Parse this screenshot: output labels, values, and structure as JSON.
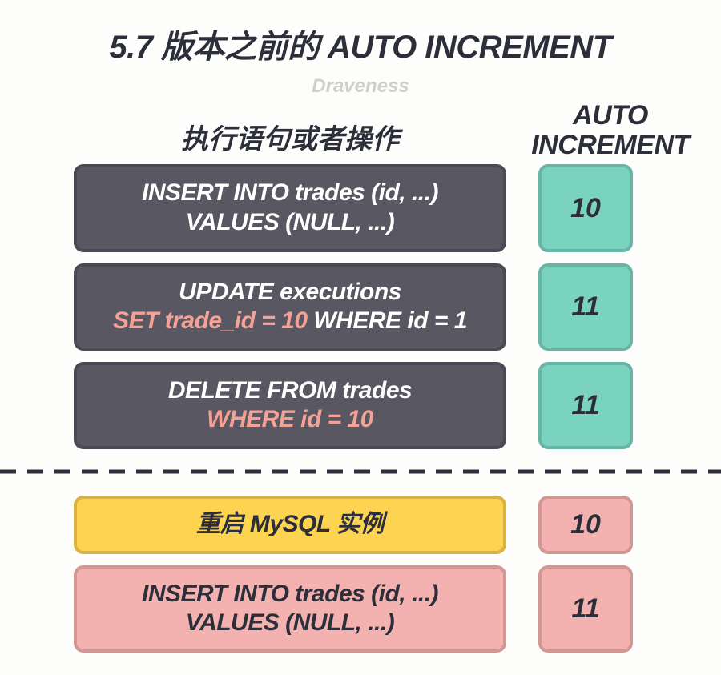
{
  "title": "5.7 版本之前的 AUTO INCREMENT",
  "subtitle": "Draveness",
  "columns": {
    "left": "执行语句或者操作",
    "right_line1": "AUTO",
    "right_line2": "INCREMENT"
  },
  "rows": [
    {
      "op_line1": "INSERT INTO trades (id, ...)",
      "op_line2": "VALUES (NULL, ...)",
      "value": "10"
    },
    {
      "op_line1": "UPDATE executions",
      "op_hl": "SET trade_id = 10",
      "op_tail": " WHERE id = 1",
      "value": "11"
    },
    {
      "op_line1": "DELETE FROM trades",
      "op_hl": "WHERE id = 10",
      "value": "11"
    },
    {
      "op_line1": "重启 MySQL 实例",
      "value": "10"
    },
    {
      "op_line1": "INSERT INTO trades (id, ...)",
      "op_line2": "VALUES (NULL, ...)",
      "value": "11"
    }
  ]
}
